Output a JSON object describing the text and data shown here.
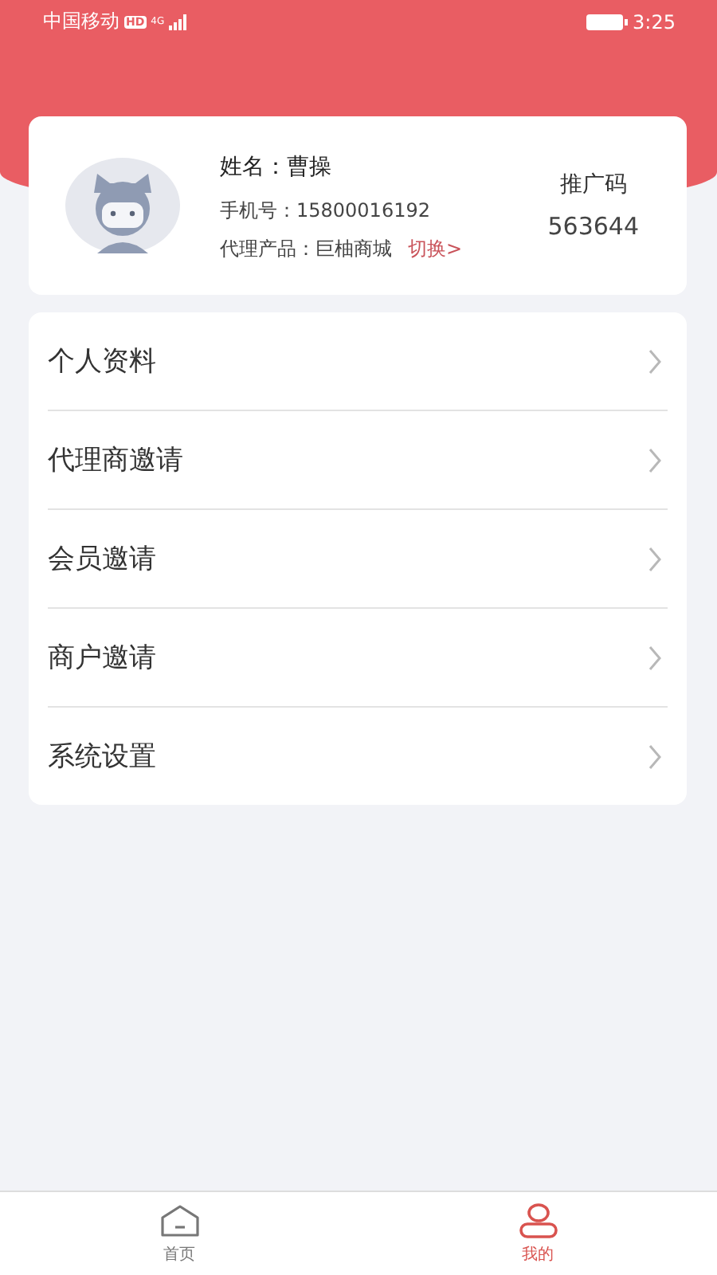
{
  "status_bar": {
    "carrier": "中国移动",
    "hd": "HD",
    "network": "4G",
    "time": "3:25"
  },
  "profile": {
    "name_label": "姓名：",
    "name": "曹操",
    "phone_label": "手机号：",
    "phone": "15800016192",
    "product_label": "代理产品：",
    "product": "巨柚商城",
    "switch_link": "切换>",
    "promo_label": "推广码",
    "promo_code": "563644"
  },
  "menu": [
    {
      "label": "个人资料"
    },
    {
      "label": "代理商邀请"
    },
    {
      "label": "会员邀请"
    },
    {
      "label": "商户邀请"
    },
    {
      "label": "系统设置"
    }
  ],
  "tabs": [
    {
      "label": "首页",
      "kind": "home",
      "selected": false
    },
    {
      "label": "我的",
      "kind": "user",
      "selected": true
    }
  ]
}
